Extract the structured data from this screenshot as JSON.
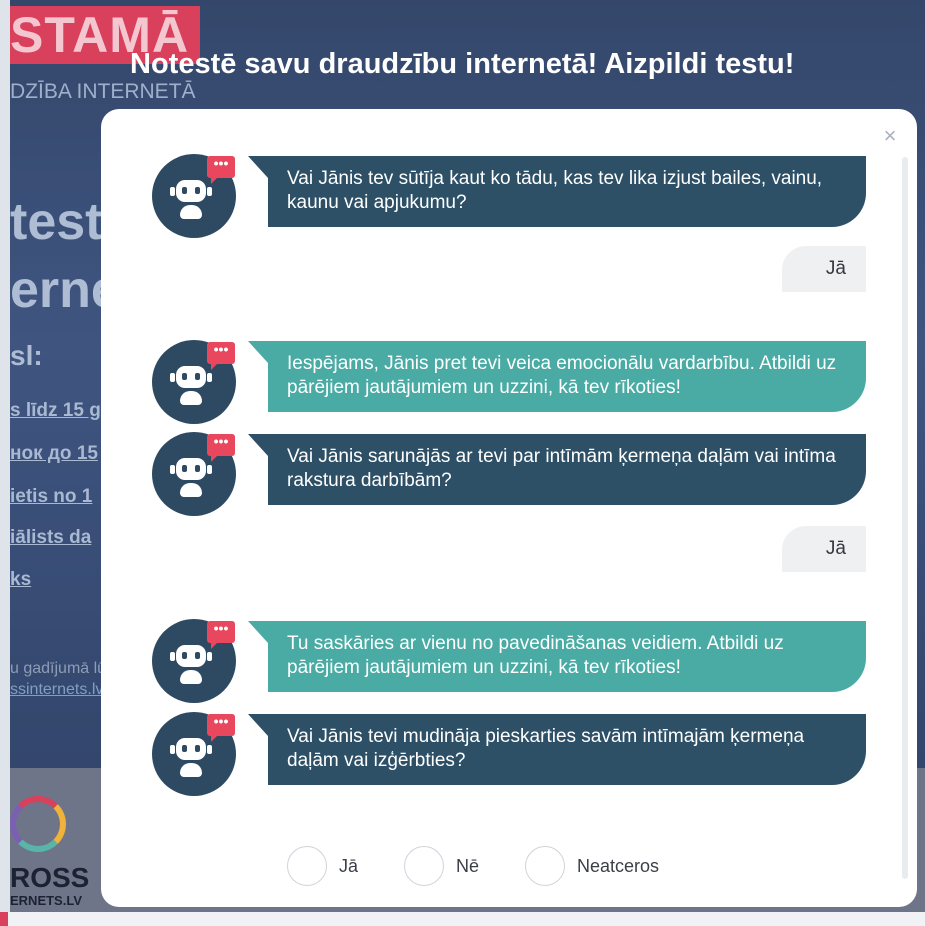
{
  "background": {
    "brand": "STAMĀ",
    "brand_sub": "DZĪBA INTERNETĀ",
    "big_line_1": "test",
    "big_line_2": "erne",
    "small_head": "sl:",
    "links": [
      "s līdz 15 g",
      "нок до 15",
      "ietis no 1",
      "iālists da",
      "ks"
    ],
    "note": "u gadījumā lū",
    "note_link": "ssinternets.lv",
    "footer_cross": "ROSS",
    "footer_net": "ERNETS.LV"
  },
  "modal": {
    "title": "Notestē savu draudzību internetā! Aizpildi testu!",
    "close_glyph": "×"
  },
  "messages": [
    {
      "from": "bot",
      "text": "Vai Jānis tev sūtīja kaut ko tādu, kas tev lika izjust bailes, vainu, kaunu vai apjukumu?"
    },
    {
      "from": "user",
      "text": "Jā"
    },
    {
      "from": "bot",
      "text": "Iespējams, Jānis pret tevi veica emocionālu vardarbību. Atbildi uz pārējiem jautājumiem un uzzini, kā tev rīkoties!"
    },
    {
      "from": "bot",
      "text": "Vai Jānis sarunājās ar tevi par intīmām ķermeņa daļām vai intīma rakstura darbībām?"
    },
    {
      "from": "user",
      "text": "Jā"
    },
    {
      "from": "bot",
      "text": "Tu saskāries ar vienu no pavedināšanas veidiem. Atbildi uz pārējiem jautājumiem un uzzini, kā tev rīkoties!"
    },
    {
      "from": "bot",
      "text": "Vai Jānis tevi mudināja pieskarties savām intīmajām ķermeņa daļām vai izģērbties?"
    }
  ],
  "avatar": {
    "badge": "•••",
    "icon": "robot-icon"
  },
  "options": [
    {
      "label": "Jā"
    },
    {
      "label": "Nē"
    },
    {
      "label": "Neatceros"
    }
  ],
  "colors": {
    "bubble_dark": "#2d5067",
    "bubble_teal": "#4aaba4",
    "badge": "#e8475d",
    "reply_bg": "#eef0f2"
  }
}
